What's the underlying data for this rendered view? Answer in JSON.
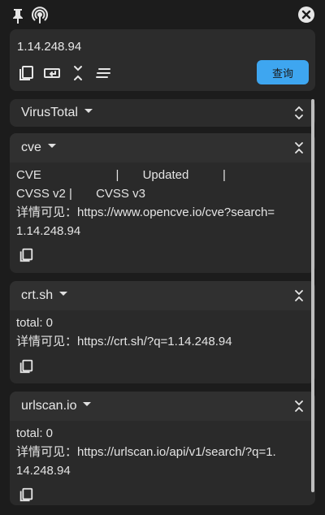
{
  "input": {
    "ip": "1.14.248.94",
    "query_label": "查询"
  },
  "source_select": {
    "value": "VirusTotal"
  },
  "panels": [
    {
      "title": "cve",
      "lines": [
        "CVE                      |       Updated          |",
        "CVSS v2 |       CVSS v3"
      ],
      "detail": "详情可见：https://www.opencve.io/cve?search=1.14.248.94"
    },
    {
      "title": "crt.sh",
      "lines": [
        "total: 0"
      ],
      "detail": "详情可见：https://crt.sh/?q=1.14.248.94"
    },
    {
      "title": "urlscan.io",
      "lines": [
        "total: 0"
      ],
      "detail": "详情可见：https://urlscan.io/api/v1/search/?q=1.14.248.94"
    }
  ],
  "icons": {
    "top_left": [
      "pin-icon",
      "signal-icon"
    ],
    "top_right": "close-icon",
    "toolbar": [
      "copy-icon",
      "enter-icon",
      "collapse-vertical-icon",
      "align-icon"
    ]
  },
  "colors": {
    "background": "#1c1c1c",
    "card": "#2c2c2c",
    "accent": "#3ea6f0",
    "text": "#e6e6e6"
  }
}
